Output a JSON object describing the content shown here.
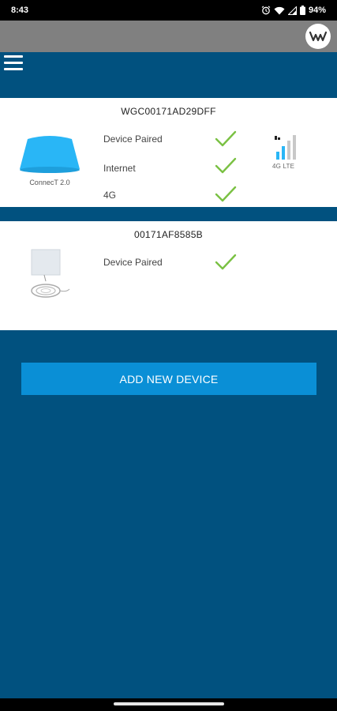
{
  "status_bar": {
    "time": "8:43",
    "battery": "94%"
  },
  "device_cards": [
    {
      "title": "WGC00171AD29DFF",
      "caption": "ConnecT 2.0",
      "statuses": [
        "Device Paired",
        "Internet",
        "4G"
      ],
      "signal_label": "4G LTE",
      "signal_bars": 2,
      "signal_max_bars": 4
    },
    {
      "title": "00171AF8585B",
      "statuses": [
        "Device Paired"
      ]
    }
  ],
  "add_button": {
    "label": "ADD NEW DEVICE"
  },
  "colors": {
    "background": "#01517f",
    "accent_button": "#0a8fd6",
    "check": "#7ac143",
    "device_blue": "#29b6f6"
  }
}
